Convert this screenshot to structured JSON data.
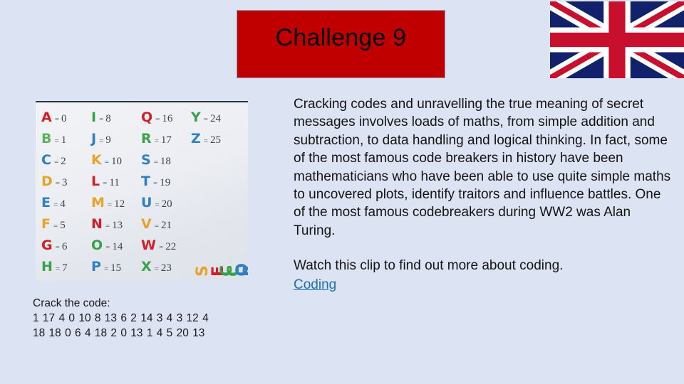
{
  "slide": {
    "background_color": "#dce3f2",
    "title": "Challenge 9",
    "title_banner_color": "#c00000"
  },
  "flag": {
    "name": "union-jack-flag",
    "colors": {
      "blue": "#12216b",
      "red": "#c8102e",
      "white": "#ffffff"
    }
  },
  "code_chart": {
    "caption": "Handwritten letter-to-number code key photograph",
    "vertical_words": [
      "SECRET",
      "CODES"
    ],
    "entries": [
      {
        "letter": "A",
        "value": "0",
        "color": "#cf2027"
      },
      {
        "letter": "B",
        "value": "1",
        "color": "#5fb25b"
      },
      {
        "letter": "C",
        "value": "2",
        "color": "#2f7fc6"
      },
      {
        "letter": "D",
        "value": "3",
        "color": "#e8a32b"
      },
      {
        "letter": "E",
        "value": "4",
        "color": "#2f7fc6"
      },
      {
        "letter": "F",
        "value": "5",
        "color": "#e8a32b"
      },
      {
        "letter": "G",
        "value": "6",
        "color": "#cf2027"
      },
      {
        "letter": "H",
        "value": "7",
        "color": "#3aa14b"
      },
      {
        "letter": "I",
        "value": "8",
        "color": "#3aa14b"
      },
      {
        "letter": "J",
        "value": "9",
        "color": "#2f7fc6"
      },
      {
        "letter": "K",
        "value": "10",
        "color": "#e8a32b"
      },
      {
        "letter": "L",
        "value": "11",
        "color": "#cf2027"
      },
      {
        "letter": "M",
        "value": "12",
        "color": "#e8a32b"
      },
      {
        "letter": "N",
        "value": "13",
        "color": "#cf2027"
      },
      {
        "letter": "O",
        "value": "14",
        "color": "#3aa14b"
      },
      {
        "letter": "P",
        "value": "15",
        "color": "#2f7fc6"
      },
      {
        "letter": "Q",
        "value": "16",
        "color": "#cf2027"
      },
      {
        "letter": "R",
        "value": "17",
        "color": "#3aa14b"
      },
      {
        "letter": "S",
        "value": "18",
        "color": "#2f7fc6"
      },
      {
        "letter": "T",
        "value": "19",
        "color": "#2f7fc6"
      },
      {
        "letter": "U",
        "value": "20",
        "color": "#2f7fc6"
      },
      {
        "letter": "V",
        "value": "21",
        "color": "#e8a32b"
      },
      {
        "letter": "W",
        "value": "22",
        "color": "#cf2027"
      },
      {
        "letter": "X",
        "value": "23",
        "color": "#3aa14b"
      },
      {
        "letter": "Y",
        "value": "24",
        "color": "#3aa14b"
      },
      {
        "letter": "Z",
        "value": "25",
        "color": "#2f7fc6"
      }
    ]
  },
  "crack_the_code": {
    "heading": "Crack the code:",
    "sequence_1": "1 17 4 0 10 8 13 6 2 14 3 4 3 12 4",
    "sequence_2": "18 18 0 6 4 18 2 0 13 1 4 5 20 13"
  },
  "body": {
    "paragraph": "Cracking codes and unravelling the true meaning of secret messages involves loads of maths, from simple addition and subtraction, to data handling and logical thinking. In fact, some of the most famous code breakers in history have been mathematicians who have been able to use quite simple maths to uncovered plots, identify traitors and influence battles. One of the most famous codebreakers during WW2 was Alan Turing.",
    "watch_line": "Watch this clip to find out more about coding.",
    "link_label": "Coding",
    "link_color": "#1f6fb5"
  }
}
